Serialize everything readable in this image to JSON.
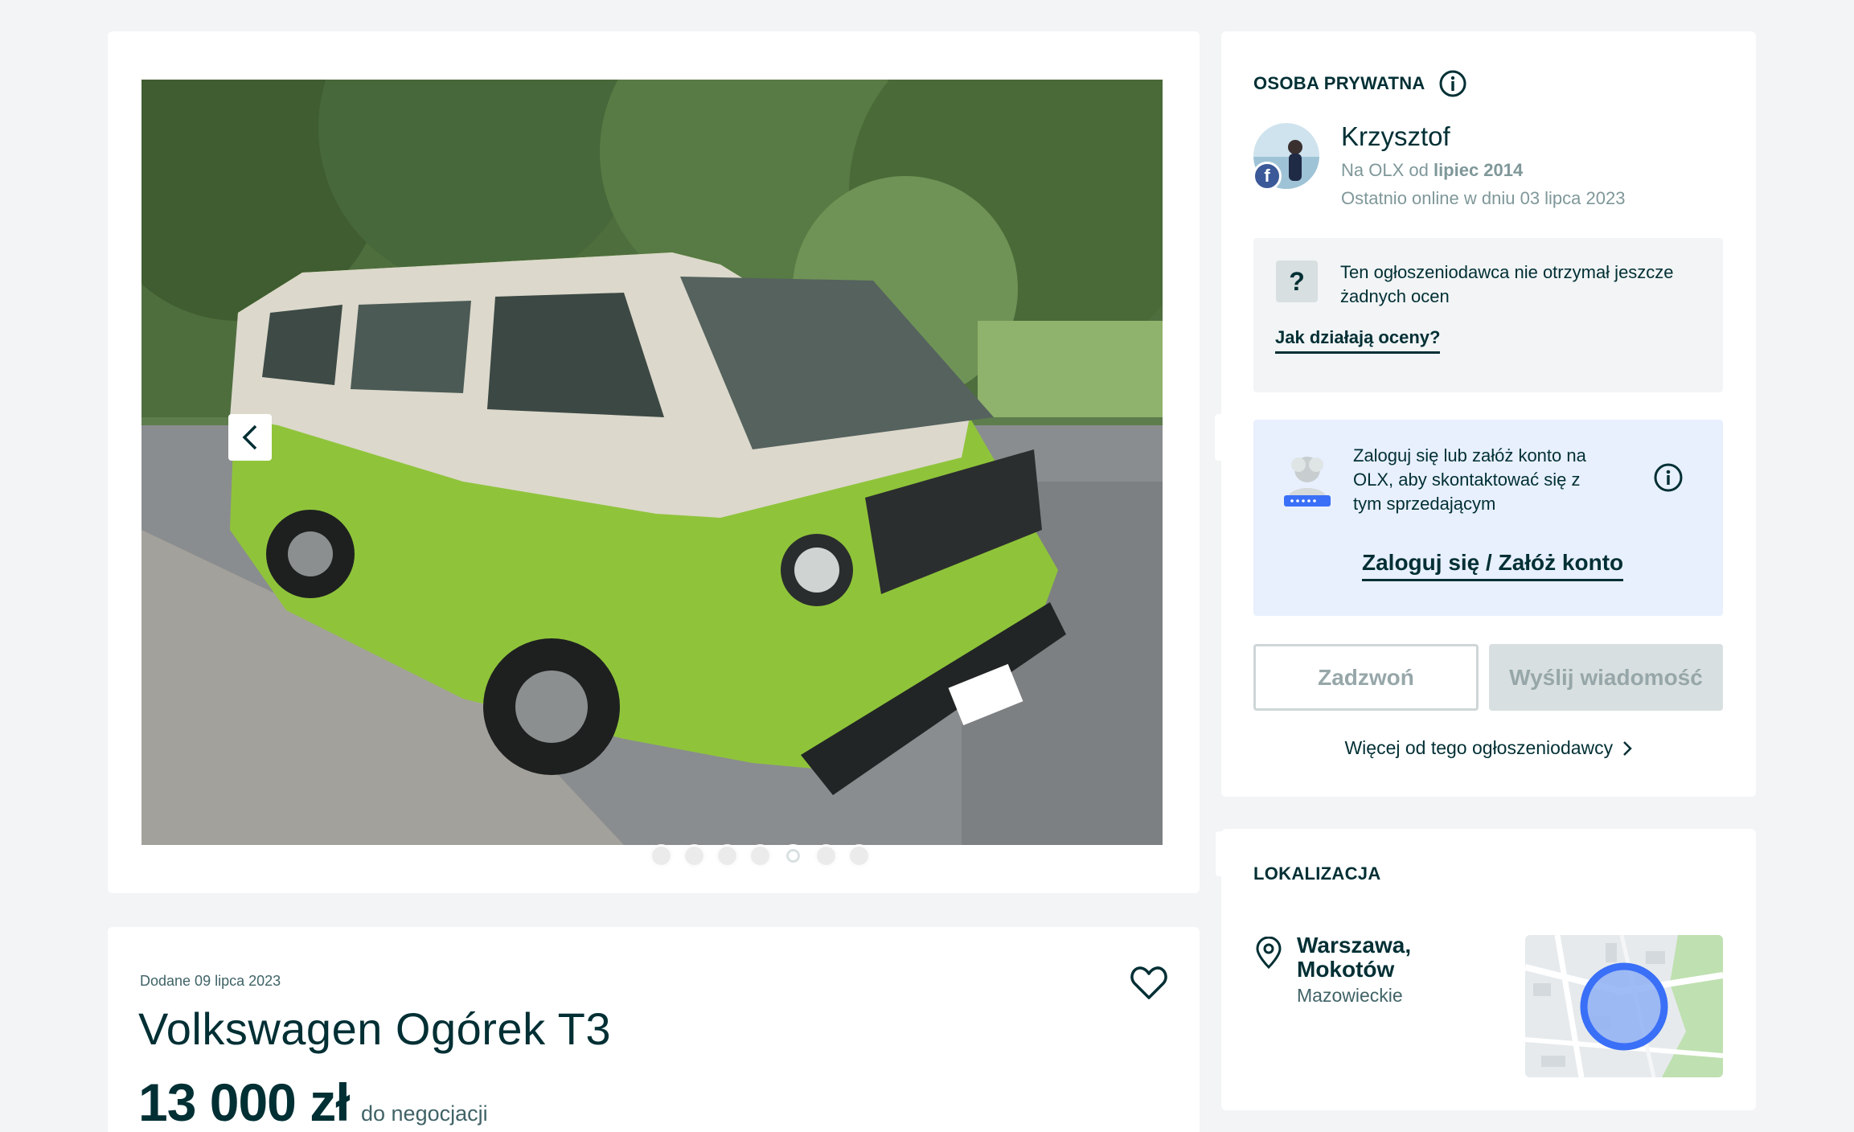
{
  "gallery": {
    "dots_total": 7,
    "active_dot": 5
  },
  "listing": {
    "added_date": "Dodane 09 lipca 2023",
    "title": "Volkswagen Ogórek T3",
    "price": "13 000 zł",
    "price_note": "do negocjacji"
  },
  "seller": {
    "type_label": "OSOBA PRYWATNA",
    "name": "Krzysztof",
    "member_since_prefix": "Na OLX od ",
    "member_since_value": "lipiec 2014",
    "last_online": "Ostatnio online w dniu 03 lipca 2023",
    "facebook_badge": "f"
  },
  "ratings": {
    "icon_glyph": "?",
    "text": "Ten ogłoszeniodawca nie otrzymał jeszcze żadnych ocen",
    "link": "Jak działają oceny?"
  },
  "login_prompt": {
    "text": "Zaloguj się lub załóż konto na OLX, aby skontaktować się z tym sprzedającym",
    "link": "Zaloguj się / Załóż konto"
  },
  "actions": {
    "call": "Zadzwoń",
    "message": "Wyślij wiadomość",
    "more_from_seller": "Więcej od tego ogłoszeniodawcy"
  },
  "location": {
    "heading": "LOKALIZACJA",
    "city": "Warszawa,",
    "district": "Mokotów",
    "region": "Mazowieckie"
  },
  "colors": {
    "text_primary": "#002f34",
    "text_muted": "#7f9799",
    "page_bg": "#f2f4f5",
    "login_box_bg": "#e8f0fe",
    "facebook": "#3b5998",
    "map_circle": "#3a6ff7"
  },
  "icons": [
    "info-icon",
    "chevron-left-icon",
    "chevron-right-icon",
    "expand-icon",
    "heart-icon",
    "question-icon",
    "location-pin-icon",
    "chevron-right-small-icon",
    "facebook-icon"
  ]
}
